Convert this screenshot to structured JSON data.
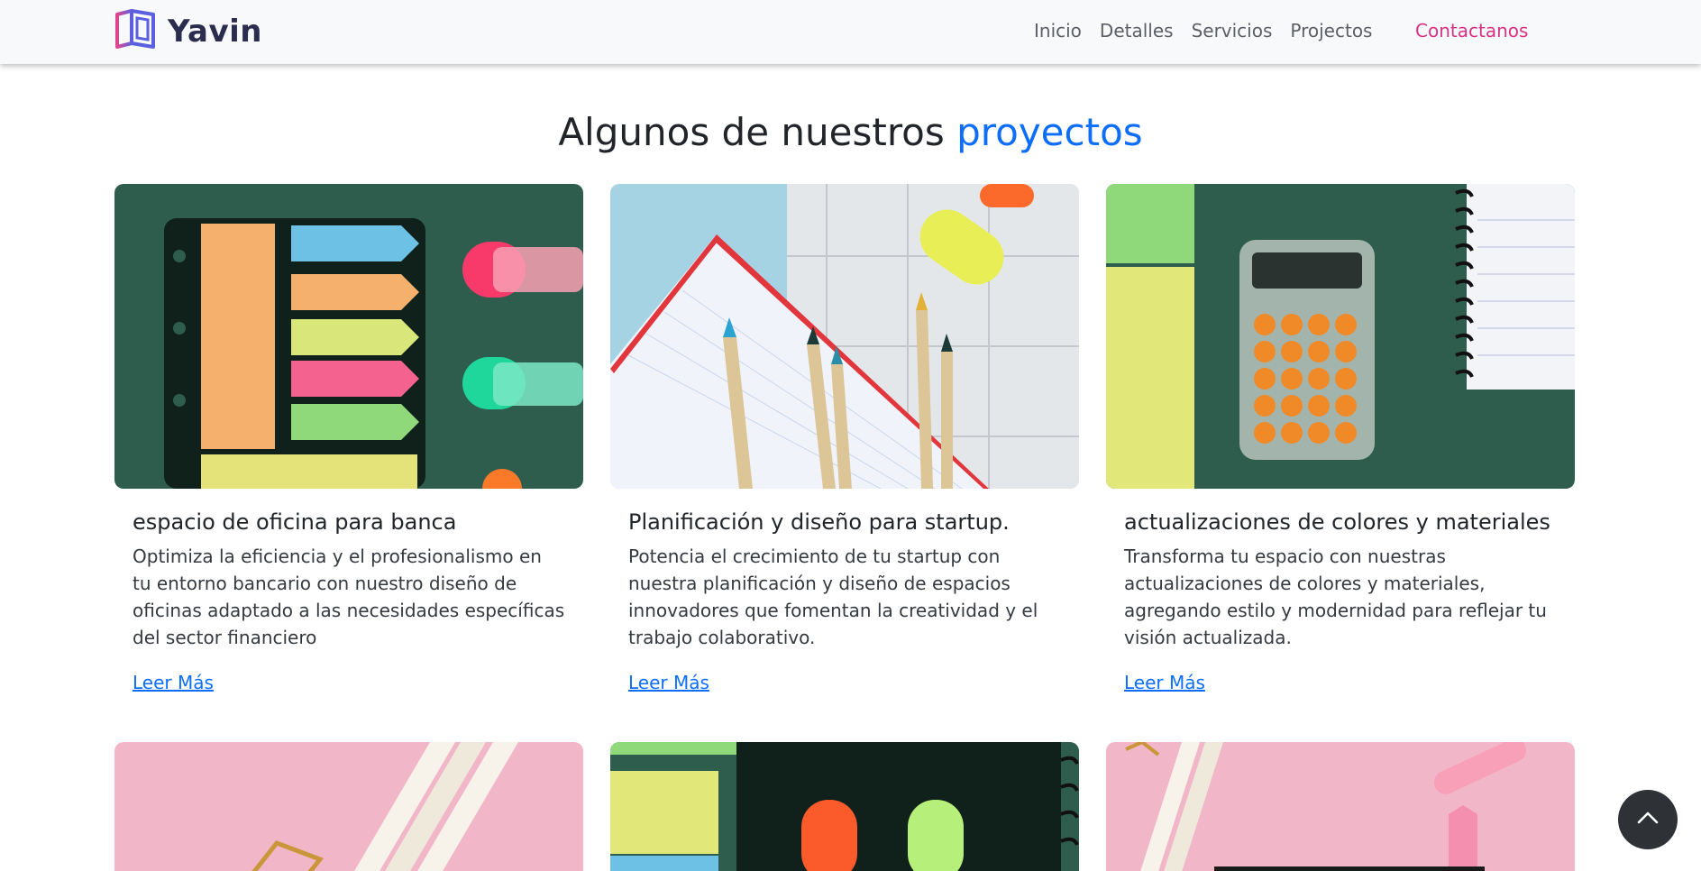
{
  "brand": {
    "name": "Yavin",
    "logo_icon": "open-book-icon"
  },
  "nav": {
    "items": [
      {
        "label": "Inicio"
      },
      {
        "label": "Detalles"
      },
      {
        "label": "Servicios"
      },
      {
        "label": "Projectos"
      }
    ],
    "contact_label": "Contactanos"
  },
  "section": {
    "title_prefix": "Algunos de nuestros",
    "title_accent": "proyectos"
  },
  "cards": [
    {
      "title": "espacio de oficina para banca",
      "text": "Optimiza la eficiencia y el profesionalismo en tu entorno bancario con nuestro diseño de oficinas adaptado a las necesidades específicas del sector financiero",
      "link": "Leer Más",
      "image": "sticky-notes-and-highlighters-photo"
    },
    {
      "title": "Planificación y diseño para startup.",
      "text": "Potencia el crecimiento de tu startup con nuestra planificación y diseño de espacios innovadores que fomentan la creatividad y el trabajo colaborativo.",
      "link": "Leer Más",
      "image": "pencils-and-notebook-photo"
    },
    {
      "title": "actualizaciones de colores y materiales",
      "text": "Transforma tu espacio con nuestras actualizaciones de colores y materiales, agregando estilo y modernidad para reflejar tu visión actualizada.",
      "link": "Leer Más",
      "image": "calculator-and-notepad-photo"
    }
  ],
  "bottom_cards": [
    {
      "image": "pink-desk-with-pencils-photo"
    },
    {
      "image": "green-desk-with-markers-photo"
    },
    {
      "image": "pink-desk-with-clip-photo"
    }
  ],
  "back_to_top": {
    "icon": "chevron-up-icon"
  },
  "colors": {
    "accent": "#0d6efd",
    "contact": "#d63384",
    "navbar_bg": "#f8f9fa",
    "brand_text": "#2b2d4e"
  }
}
